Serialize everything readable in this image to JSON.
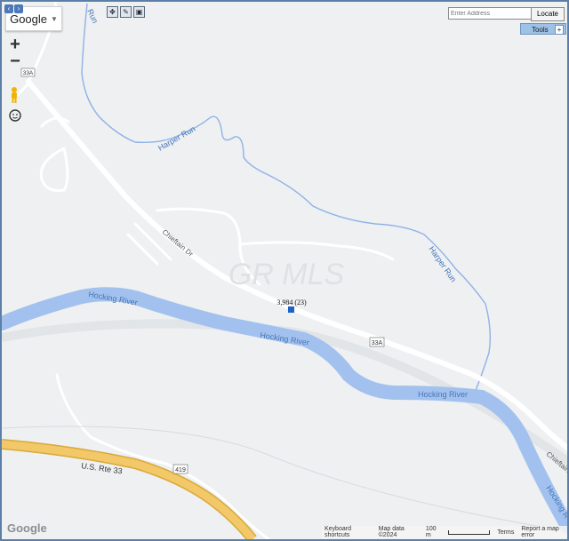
{
  "google_menu": {
    "label": "Google"
  },
  "zoom": {
    "in_label": "+",
    "out_label": "−"
  },
  "search": {
    "placeholder": "Enter Address",
    "locate_label": "Locate"
  },
  "tools": {
    "label": "Tools"
  },
  "map": {
    "watermark": "GR MLS",
    "marker_label": "3,984 (23)",
    "labels": {
      "harper_run_1": "Harper Run",
      "harper_run_2": "Harper Run",
      "harper_run_3": "Run",
      "chieftain_dr": "Chieftain Dr",
      "chieftain_dr_edge": "Chieftain",
      "hocking_river_1": "Hocking River",
      "hocking_river_2": "Hocking River",
      "hocking_river_3": "Hocking River",
      "hocking_river_edge": "Hocking R",
      "us_rte_33": "U.S. Rte 33",
      "shield_33a_1": "33A",
      "shield_33a_2": "33A",
      "shield_419": "419"
    },
    "colors": {
      "land": "#eef0f2",
      "water": "#a3c1ee",
      "water_label": "#4577b8",
      "road": "#ffffff",
      "highway": "#f2c868",
      "highway_edge": "#d9a93a"
    }
  },
  "footer": {
    "shortcuts": "Keyboard shortcuts",
    "map_data": "Map data ©2024",
    "scale": "100 m",
    "terms": "Terms",
    "report": "Report a map error"
  },
  "logo": "Google"
}
